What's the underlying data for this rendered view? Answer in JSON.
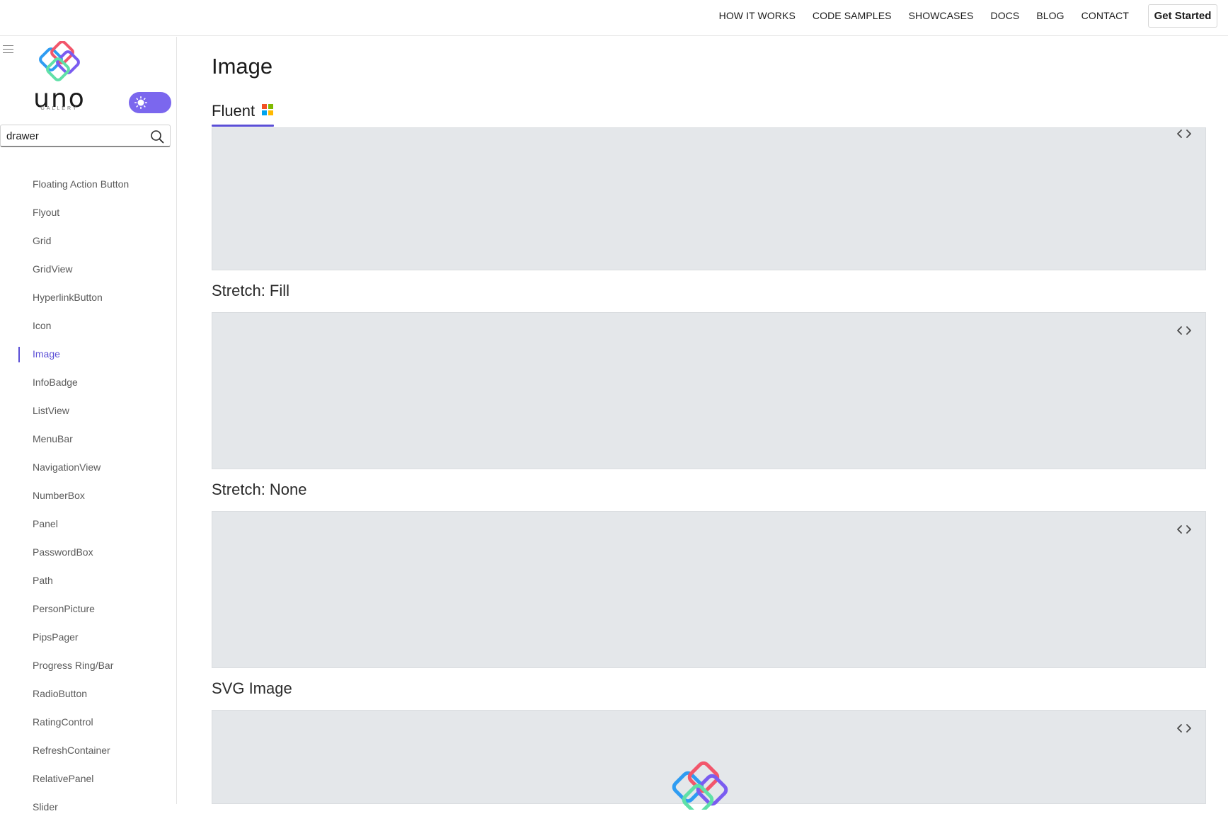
{
  "topnav": {
    "items": [
      "HOW IT WORKS",
      "CODE SAMPLES",
      "SHOWCASES",
      "DOCS",
      "BLOG",
      "CONTACT"
    ],
    "cta": "Get Started"
  },
  "sidebar": {
    "brand": "uno",
    "brand_sub": "GALLERY",
    "search": {
      "value": "drawer",
      "placeholder": ""
    },
    "items": [
      {
        "label": "Floating Action Button"
      },
      {
        "label": "Flyout"
      },
      {
        "label": "Grid"
      },
      {
        "label": "GridView"
      },
      {
        "label": "HyperlinkButton"
      },
      {
        "label": "Icon"
      },
      {
        "label": "Image",
        "active": true
      },
      {
        "label": "InfoBadge"
      },
      {
        "label": "ListView"
      },
      {
        "label": "MenuBar"
      },
      {
        "label": "NavigationView"
      },
      {
        "label": "NumberBox"
      },
      {
        "label": "Panel"
      },
      {
        "label": "PasswordBox"
      },
      {
        "label": "Path"
      },
      {
        "label": "PersonPicture"
      },
      {
        "label": "PipsPager"
      },
      {
        "label": "Progress Ring/Bar"
      },
      {
        "label": "RadioButton"
      },
      {
        "label": "RatingControl"
      },
      {
        "label": "RefreshContainer"
      },
      {
        "label": "RelativePanel"
      },
      {
        "label": "Slider"
      }
    ]
  },
  "main": {
    "title": "Image",
    "tab": "Fluent",
    "sections": [
      {
        "title": "Stretch: Fill"
      },
      {
        "title": "Stretch: None"
      },
      {
        "title": "SVG Image"
      }
    ]
  },
  "colors": {
    "accent": "#5b4fd6",
    "toggle": "#7b67ee",
    "panel": "#e4e7ea"
  },
  "icons": {
    "menu": "hamburger-icon",
    "search": "search-icon",
    "theme": "sun-icon",
    "code": "code-icon"
  }
}
